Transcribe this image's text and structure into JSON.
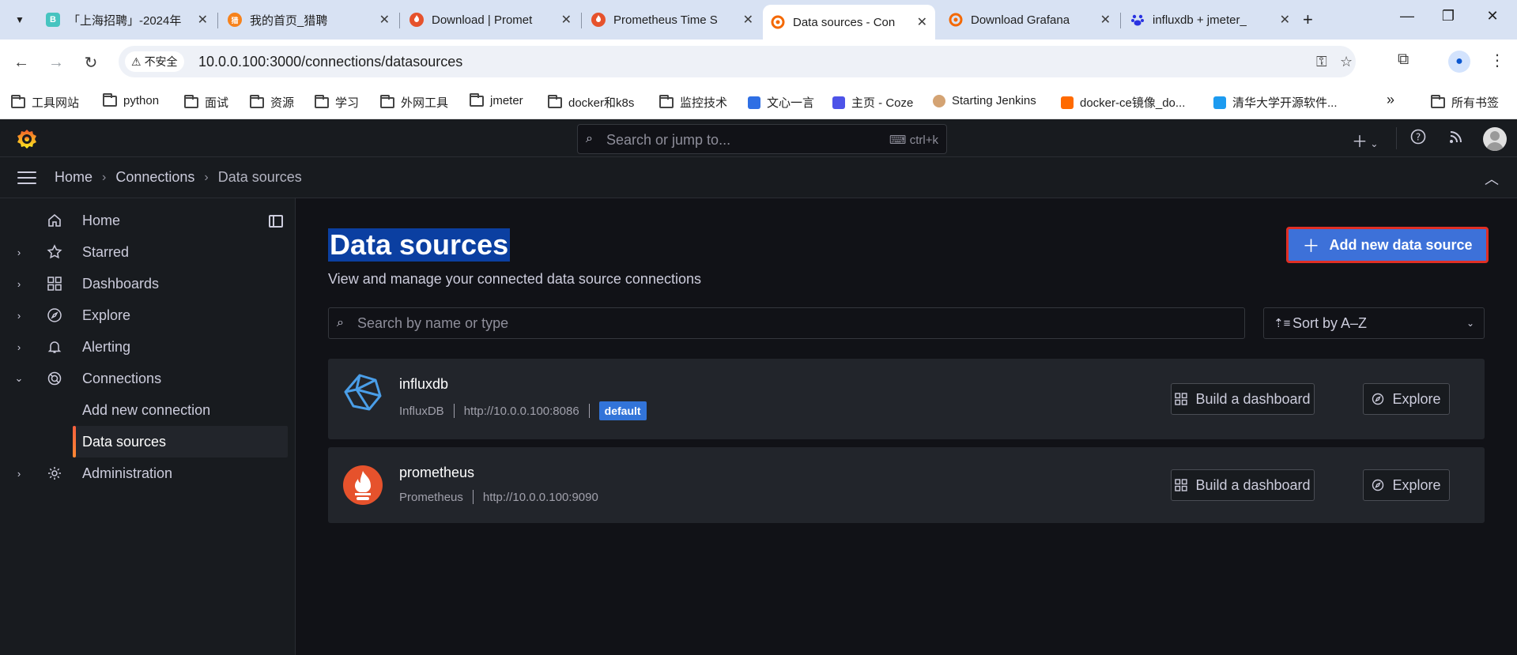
{
  "browser": {
    "tabs": [
      {
        "title": "「上海招聘」-2024年",
        "color": "#46c4c0",
        "glyph": "B"
      },
      {
        "title": "我的首页_猎聘",
        "color": "#f7821b",
        "glyph": "猎"
      },
      {
        "title": "Download | Promet",
        "color": "#e6522c",
        "glyph": ""
      },
      {
        "title": "Prometheus Time S",
        "color": "#e6522c",
        "glyph": ""
      },
      {
        "title": "Data sources - Con",
        "color": "#f46800",
        "glyph": ""
      },
      {
        "title": "Download Grafana",
        "color": "#f46800",
        "glyph": ""
      },
      {
        "title": "influxdb + jmeter_",
        "color": "#2932e1",
        "glyph": ""
      }
    ],
    "security_label": "不安全",
    "url": "10.0.0.100:3000/connections/datasources",
    "bookmarks": [
      {
        "label": "工具网站",
        "type": "folder"
      },
      {
        "label": "python",
        "type": "folder"
      },
      {
        "label": "面试",
        "type": "folder"
      },
      {
        "label": "资源",
        "type": "folder"
      },
      {
        "label": "学习",
        "type": "folder"
      },
      {
        "label": "外网工具",
        "type": "folder"
      },
      {
        "label": "jmeter",
        "type": "folder"
      },
      {
        "label": "docker和k8s",
        "type": "folder"
      },
      {
        "label": "监控技术",
        "type": "folder"
      },
      {
        "label": "文心一言",
        "type": "site",
        "color": "#2f6fe4"
      },
      {
        "label": "主页 - Coze",
        "type": "site",
        "color": "#4d53e8"
      },
      {
        "label": "Starting Jenkins",
        "type": "site",
        "color": "#d4a373"
      },
      {
        "label": "docker-ce镜像_do...",
        "type": "site",
        "color": "#ff6a00"
      },
      {
        "label": "清华大学开源软件...",
        "type": "site",
        "color": "#1d9bf0"
      }
    ],
    "more_bookmarks": "»",
    "all_bookmarks": "所有书签"
  },
  "grafana": {
    "search_placeholder": "Search or jump to...",
    "search_shortcut": "ctrl+k",
    "breadcrumb": [
      "Home",
      "Connections",
      "Data sources"
    ],
    "nav": [
      {
        "label": "Home",
        "icon": "home-icon",
        "expandable": false
      },
      {
        "label": "Starred",
        "icon": "star-icon",
        "expandable": true
      },
      {
        "label": "Dashboards",
        "icon": "apps-icon",
        "expandable": true
      },
      {
        "label": "Explore",
        "icon": "compass-icon",
        "expandable": true
      },
      {
        "label": "Alerting",
        "icon": "bell-icon",
        "expandable": true
      },
      {
        "label": "Connections",
        "icon": "connections-icon",
        "expandable": true,
        "expanded": true
      },
      {
        "label": "Add new connection",
        "sub": true
      },
      {
        "label": "Data sources",
        "sub": true,
        "active": true
      },
      {
        "label": "Administration",
        "icon": "cog-icon",
        "expandable": true
      }
    ],
    "page": {
      "title": "Data sources",
      "subtitle": "View and manage your connected data source connections",
      "add_button": "Add new data source",
      "filter_placeholder": "Search by name or type",
      "sort_value": "Sort by A–Z"
    },
    "datasources": [
      {
        "name": "influxdb",
        "type": "InfluxDB",
        "url": "http://10.0.0.100:8086",
        "badge": "default",
        "build_label": "Build a dashboard",
        "explore_label": "Explore"
      },
      {
        "name": "prometheus",
        "type": "Prometheus",
        "url": "http://10.0.0.100:9090",
        "badge": "",
        "build_label": "Build a dashboard",
        "explore_label": "Explore"
      }
    ]
  }
}
